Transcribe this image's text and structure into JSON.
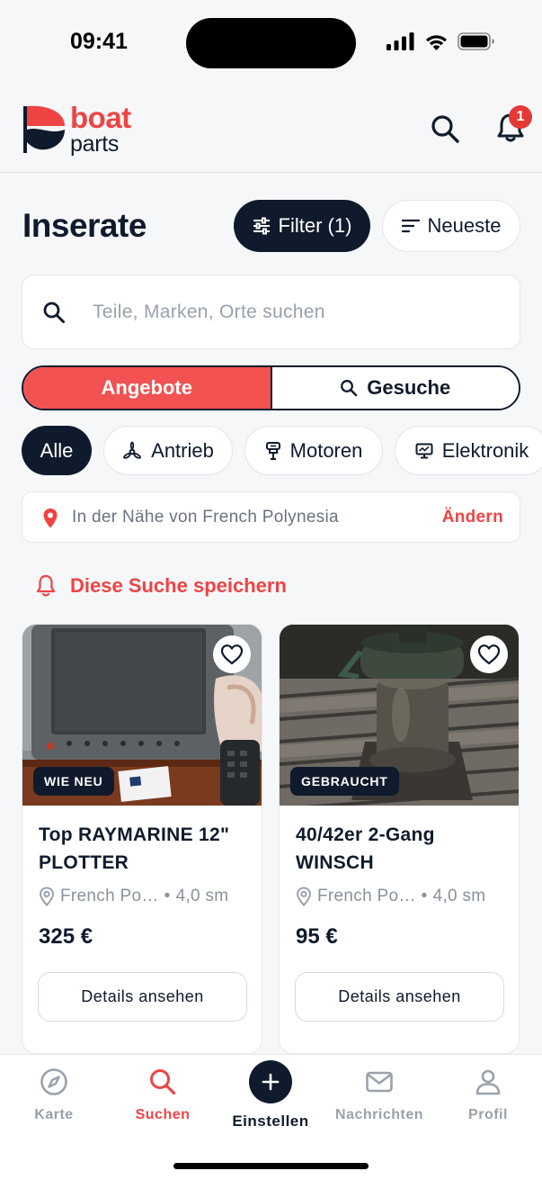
{
  "status": {
    "time": "09:41"
  },
  "header": {
    "logo_line1": "boat",
    "logo_line2": "parts",
    "notification_count": "1"
  },
  "page": {
    "title": "Inserate",
    "filter_label": "Filter (1)",
    "sort_label": "Neueste"
  },
  "search": {
    "placeholder": "Teile, Marken, Orte suchen",
    "value": ""
  },
  "segments": {
    "offers": "Angebote",
    "requests": "Gesuche",
    "selected": "offers"
  },
  "categories": [
    {
      "label": "Alle",
      "icon": "none",
      "active": true
    },
    {
      "label": "Antrieb",
      "icon": "propeller-icon",
      "active": false
    },
    {
      "label": "Motoren",
      "icon": "engine-icon",
      "active": false
    },
    {
      "label": "Elektronik",
      "icon": "monitor-icon",
      "active": false
    }
  ],
  "location": {
    "text": "In der Nähe von French Polynesia",
    "change": "Ändern"
  },
  "save_search": "Diese Suche speichern",
  "listings": [
    {
      "title": "Top RAYMARINE 12\" PLOTTER",
      "condition": "WIE NEU",
      "location": "French Po…",
      "distance": "4,0 sm",
      "price": "325 €",
      "button": "Details ansehen",
      "image": "chartplotter-photo"
    },
    {
      "title": "40/42er 2-Gang WINSCH",
      "condition": "GEBRAUCHT",
      "location": "French Po…",
      "distance": "4,0 sm",
      "price": "95 €",
      "button": "Details ansehen",
      "image": "winch-photo"
    }
  ],
  "tabbar": {
    "map": "Karte",
    "search": "Suchen",
    "add": "Einstellen",
    "messages": "Nachrichten",
    "profile": "Profil",
    "active": "search"
  },
  "colors": {
    "accent": "#ef4444",
    "navy": "#0f1b2d",
    "background": "#f6f7f9"
  }
}
